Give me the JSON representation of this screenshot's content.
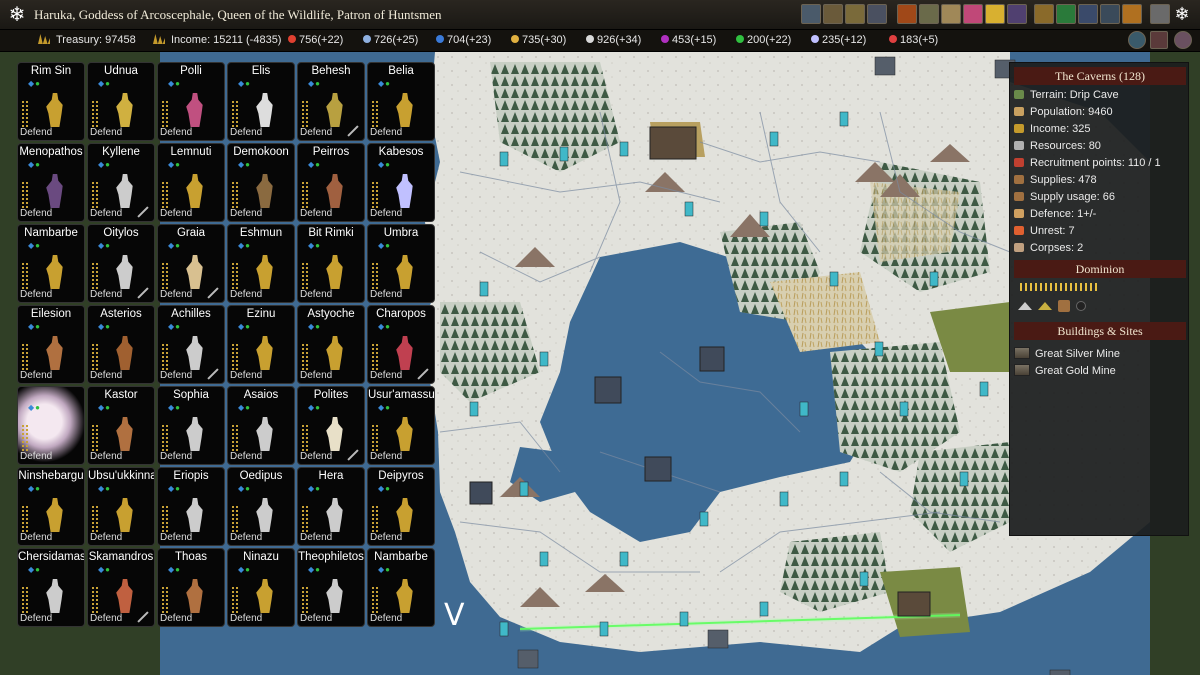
{
  "window": {
    "title": "Haruka, Goddess of Arcoscephale, Queen of the Wildlife, Patron of Huntsmen"
  },
  "toolbar": {
    "icons": [
      "army-setup-icon",
      "recruit-icon",
      "castle-icon",
      "tombstone-icon",
      "fire-icon",
      "feather-icon",
      "hand-icon",
      "skull-icon",
      "sun-icon",
      "void-icon",
      "treasure-icon",
      "herb-icon",
      "wave-icon",
      "mountain-icon",
      "flame-icon",
      "message-icon",
      "settings-icon"
    ]
  },
  "resources": {
    "treasury": "Treasury: 97458",
    "income": "Income: 15211 (-4835)",
    "gems": [
      {
        "name": "fire-gem-icon",
        "color": "#e04030",
        "text": "756(+22)"
      },
      {
        "name": "air-gem-icon",
        "color": "#8fb0e0",
        "text": "726(+25)"
      },
      {
        "name": "water-gem-icon",
        "color": "#3a7ad8",
        "text": "704(+23)"
      },
      {
        "name": "earth-gem-icon",
        "color": "#e0b040",
        "text": "735(+30)"
      },
      {
        "name": "astral-pearl-icon",
        "color": "#d8d8d8",
        "text": "926(+34)"
      },
      {
        "name": "death-gem-icon",
        "color": "#b030c0",
        "text": "453(+15)"
      },
      {
        "name": "nature-gem-icon",
        "color": "#30c040",
        "text": "200(+22)"
      },
      {
        "name": "blood-slave-icon",
        "color": "#c0c0ff",
        "text": "235(+12)"
      },
      {
        "name": "unknown-resource-icon",
        "color": "#e04040",
        "text": "183(+5)"
      }
    ]
  },
  "commanders": [
    {
      "name": "Rim Sin",
      "order": "Defend"
    },
    {
      "name": "Udnua",
      "order": "Defend"
    },
    {
      "name": "Polli",
      "order": "Defend"
    },
    {
      "name": "Elis",
      "order": "Defend"
    },
    {
      "name": "Behesh",
      "order": "Defend"
    },
    {
      "name": "Belia",
      "order": "Defend"
    },
    {
      "name": "Menopathos",
      "order": "Defend"
    },
    {
      "name": "Kyllene",
      "order": "Defend"
    },
    {
      "name": "Lemnuti",
      "order": "Defend"
    },
    {
      "name": "Demokoon",
      "order": "Defend"
    },
    {
      "name": "Peirros",
      "order": "Defend"
    },
    {
      "name": "Kabesos",
      "order": "Defend"
    },
    {
      "name": "Nambarbe",
      "order": "Defend"
    },
    {
      "name": "Oitylos",
      "order": "Defend"
    },
    {
      "name": "Graia",
      "order": "Defend"
    },
    {
      "name": "Eshmun",
      "order": "Defend"
    },
    {
      "name": "Bit Rimki",
      "order": "Defend"
    },
    {
      "name": "Umbra",
      "order": "Defend"
    },
    {
      "name": "Eilesion",
      "order": "Defend"
    },
    {
      "name": "Asterios",
      "order": "Defend"
    },
    {
      "name": "Achilles",
      "order": "Defend"
    },
    {
      "name": "Ezinu",
      "order": "Defend"
    },
    {
      "name": "Astyoche",
      "order": "Defend"
    },
    {
      "name": "Charopos",
      "order": "Defend"
    },
    {
      "name": "",
      "order": "Defend"
    },
    {
      "name": "Kastor",
      "order": "Defend"
    },
    {
      "name": "Sophia",
      "order": "Defend"
    },
    {
      "name": "Asaios",
      "order": "Defend"
    },
    {
      "name": "Polites",
      "order": "Defend"
    },
    {
      "name": "Usur'amassu",
      "order": "Defend"
    },
    {
      "name": "Ninshebargu",
      "order": "Defend"
    },
    {
      "name": "Ubsu'ukkinna",
      "order": "Defend"
    },
    {
      "name": "Eriopis",
      "order": "Defend"
    },
    {
      "name": "Oedipus",
      "order": "Defend"
    },
    {
      "name": "Hera",
      "order": "Defend"
    },
    {
      "name": "Deipyros",
      "order": "Defend"
    },
    {
      "name": "Chersidamas",
      "order": "Defend"
    },
    {
      "name": "Skamandros",
      "order": "Defend"
    },
    {
      "name": "Thoas",
      "order": "Defend"
    },
    {
      "name": "Ninazu",
      "order": "Defend"
    },
    {
      "name": "Theophiletos",
      "order": "Defend"
    },
    {
      "name": "Nambarbe",
      "order": "Defend"
    }
  ],
  "province": {
    "title": "The Caverns (128)",
    "rows": [
      {
        "icon": "terrain-icon",
        "color": "#6a8a4a",
        "text": "Terrain: Drip Cave"
      },
      {
        "icon": "population-icon",
        "color": "#c8a060",
        "text": "Population: 9460"
      },
      {
        "icon": "income-icon",
        "color": "#c49a2c",
        "text": "Income: 325"
      },
      {
        "icon": "resources-icon",
        "color": "#b0b0b0",
        "text": "Resources: 80"
      },
      {
        "icon": "recruitment-icon",
        "color": "#c04030",
        "text": "Recruitment points: 110 / 1"
      },
      {
        "icon": "supplies-icon",
        "color": "#a07040",
        "text": "Supplies: 478"
      },
      {
        "icon": "supply-usage-icon",
        "color": "#a07040",
        "text": "Supply usage: 66"
      },
      {
        "icon": "defence-icon",
        "color": "#d0a060",
        "text": "Defence: 1+/-"
      },
      {
        "icon": "unrest-icon",
        "color": "#e06030",
        "text": "Unrest: 7"
      },
      {
        "icon": "corpses-icon",
        "color": "#c0a080",
        "text": "Corpses: 2"
      }
    ],
    "dominion_title": "Dominion",
    "sites_title": "Buildings & Sites",
    "sites": [
      "Great Silver Mine",
      "Great Gold Mine"
    ]
  },
  "map": {
    "nav_arrow": "V"
  }
}
